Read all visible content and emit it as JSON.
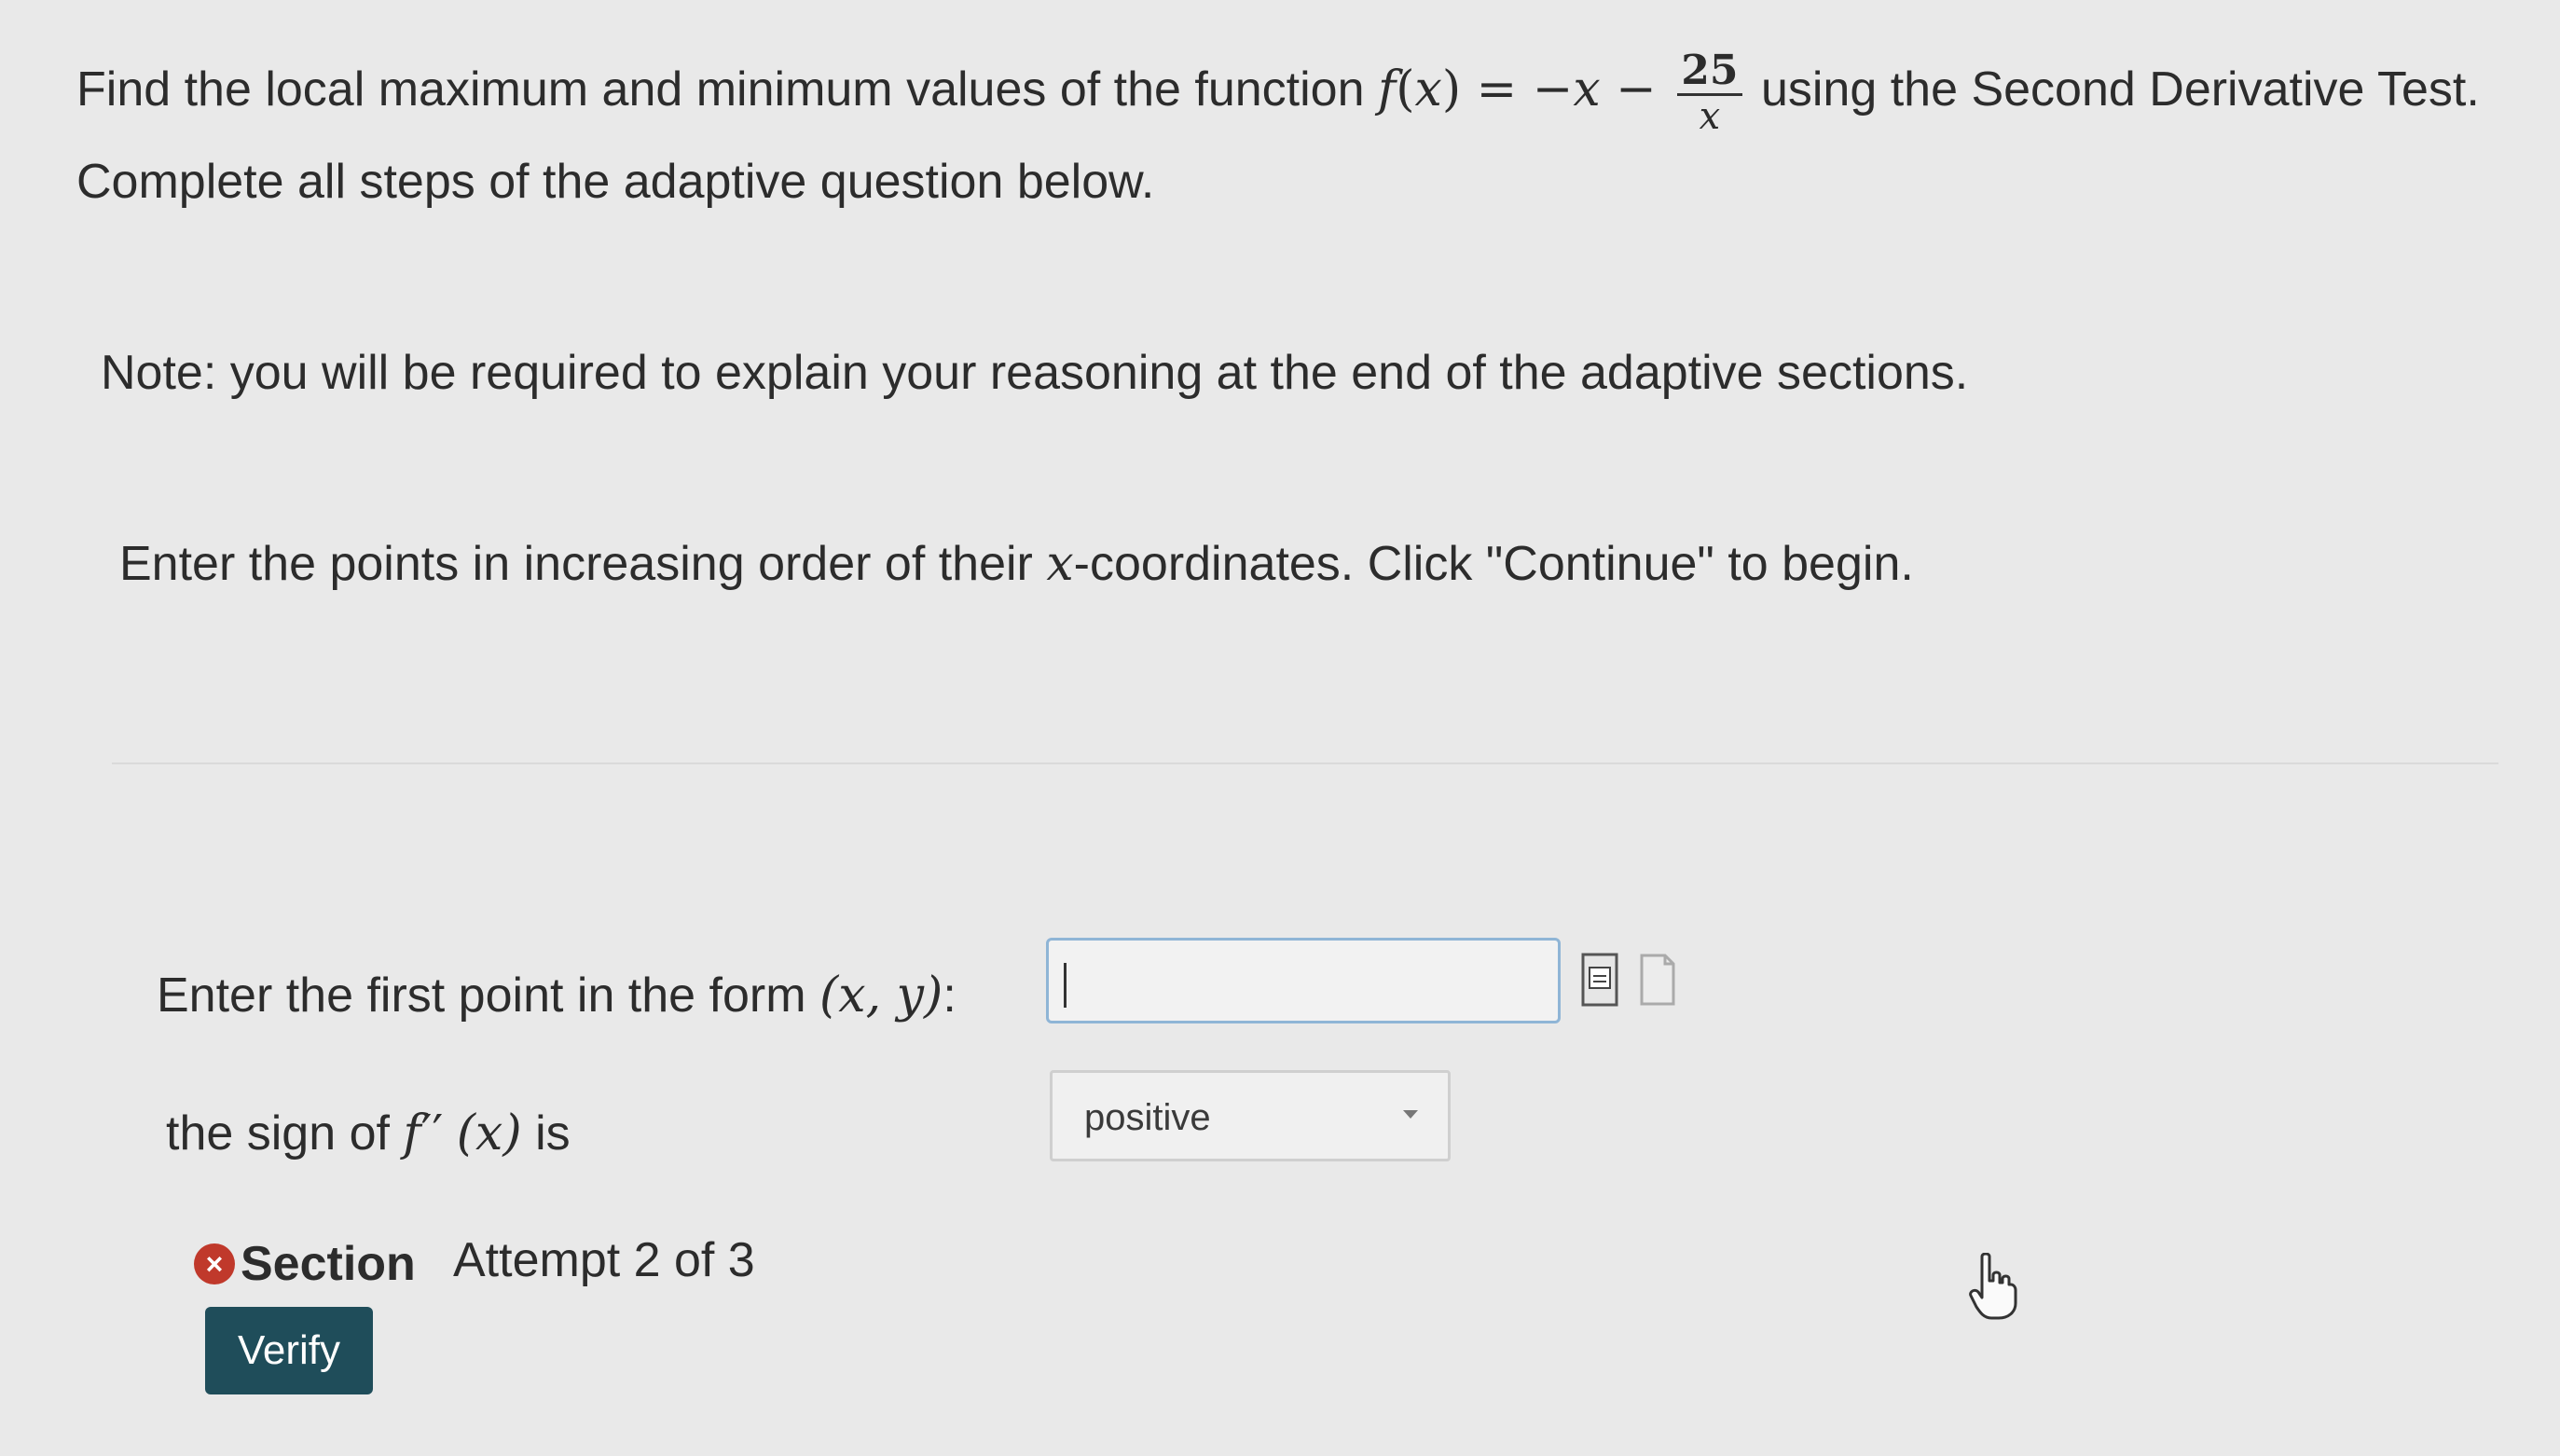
{
  "question": {
    "text_before": "Find the local maximum and minimum values of the function ",
    "func": "f",
    "var": "x",
    "rhs_prefix": " = −x − ",
    "frac_num": "25",
    "frac_den": "x",
    "text_after": " using the Second Derivative Test. Complete all steps of the adaptive question below."
  },
  "note": "Note: you will be required to explain your reasoning at the end of the adaptive sections.",
  "instruction": {
    "before": "Enter the points in increasing order of their ",
    "var": "x",
    "after": "-coordinates. Click \"Continue\" to begin."
  },
  "point_prompt": {
    "text": "Enter the first point in the form ",
    "form": "(x, y)",
    "colon": ":"
  },
  "point_input": {
    "value": ""
  },
  "sign_prompt": {
    "before": "the sign of ",
    "func": "f",
    "prime": "′′",
    "arg": "(x)",
    "after": " is"
  },
  "sign_select": {
    "value": "positive"
  },
  "section": {
    "label": "Section",
    "attempt": "Attempt 2 of 3"
  },
  "verify_label": "Verify",
  "icons": {
    "status": "x-circle-icon",
    "preview": "preview-document-icon",
    "help": "blank-document-icon",
    "cursor": "mouse-cursor-icon"
  },
  "colors": {
    "verify_bg": "#1f4d5a",
    "status_icon": "#c0392b",
    "input_border": "#8fb5d6"
  }
}
